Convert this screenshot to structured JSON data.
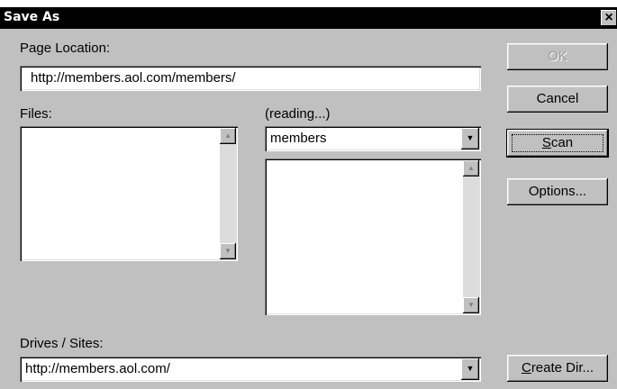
{
  "window": {
    "title": "Save As",
    "close_glyph": "×"
  },
  "page_location": {
    "label": "Page Location:",
    "value": "http://members.aol.com/members/"
  },
  "files": {
    "label": "Files:"
  },
  "directories": {
    "status_label": "(reading...)",
    "selected": "members"
  },
  "drives": {
    "label": "Drives / Sites:",
    "selected": "http://members.aol.com/"
  },
  "buttons": {
    "ok": "OK",
    "cancel": "Cancel",
    "scan_mnemonic": "S",
    "scan_rest": "can",
    "options": "Options...",
    "create_dir_mnemonic": "C",
    "create_dir_rest": "reate Dir..."
  },
  "icons": {
    "scroll_up": "▲",
    "scroll_down": "▼",
    "dropdown": "▼"
  }
}
